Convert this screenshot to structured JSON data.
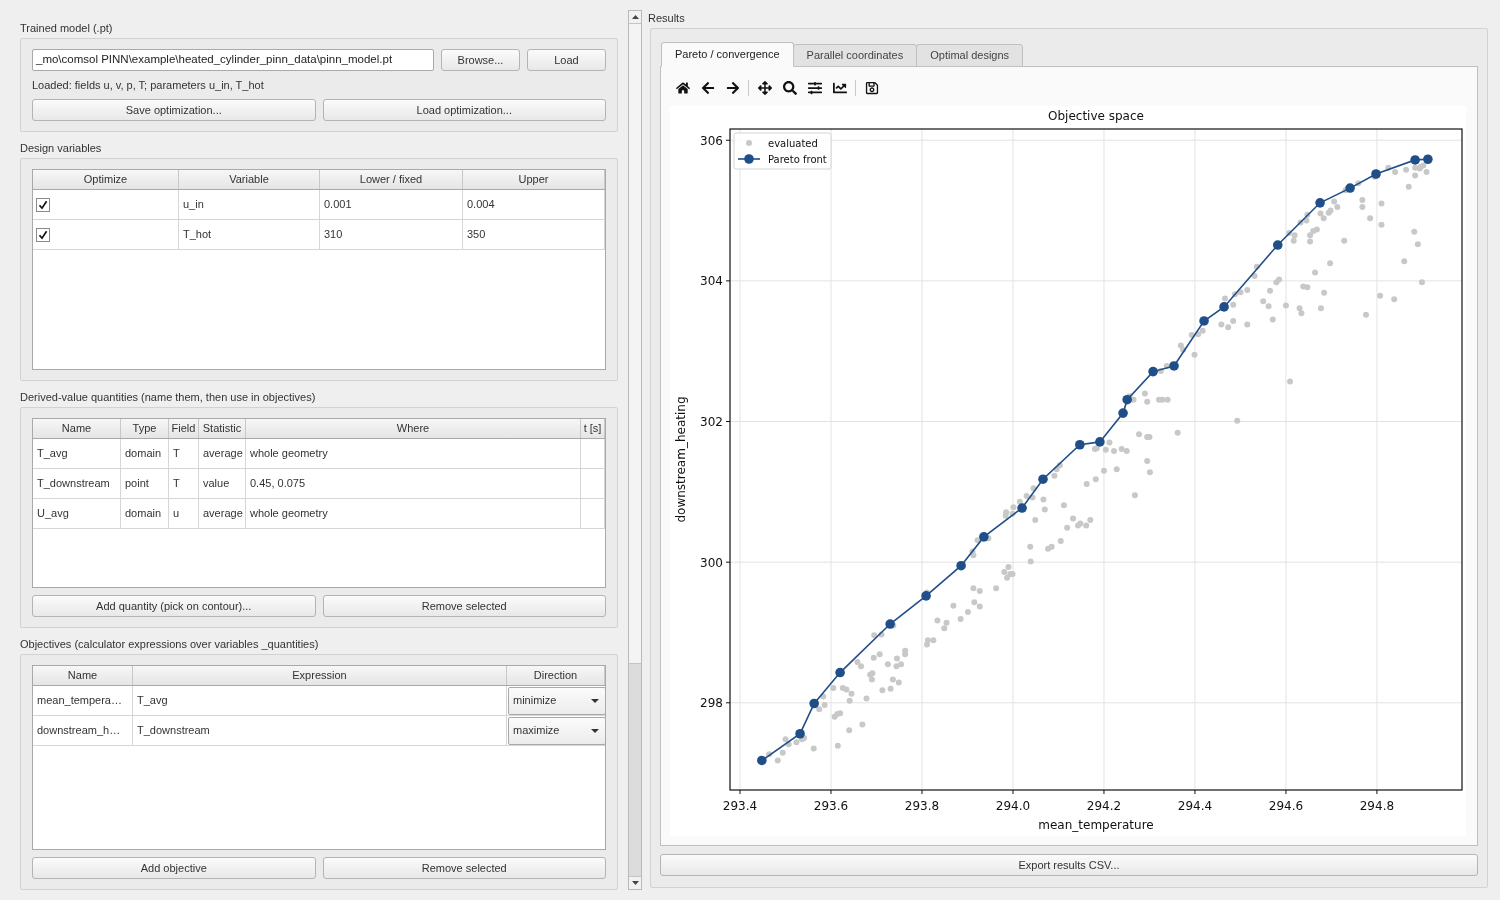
{
  "trained_model": {
    "title": "Trained model (.pt)",
    "path_field": {
      "value": "_mo\\comsol PINN\\example\\heated_cylinder_pinn_data\\pinn_model.pt"
    },
    "buttons": [
      "Browse...",
      "Load"
    ],
    "status": "Loaded: fields u, v, p, T; parameters u_in, T_hot",
    "file_buttons": [
      "Save optimization...",
      "Load optimization..."
    ]
  },
  "design_variables": {
    "title": "Design variables",
    "columns": [
      "Optimize",
      "Variable",
      "Lower / fixed",
      "Upper"
    ],
    "rows": [
      {
        "checked": true,
        "variable": "u_in",
        "lower": "0.001",
        "upper": "0.004"
      },
      {
        "checked": true,
        "variable": "T_hot",
        "lower": "310",
        "upper": "350"
      }
    ]
  },
  "quantities": {
    "title": "Derived-value quantities (name them, then use in objectives)",
    "columns": [
      "Name",
      "Type",
      "Field",
      "Statistic",
      "Where",
      "t [s]"
    ],
    "rows": [
      {
        "name": "T_avg",
        "type": "domain",
        "field": "T",
        "statistic": "average",
        "where": "whole geometry"
      },
      {
        "name": "T_downstream",
        "type": "point",
        "field": "T",
        "statistic": "value",
        "where": "0.45, 0.075"
      },
      {
        "name": "U_avg",
        "type": "domain",
        "field": "u",
        "statistic": "average",
        "where": "whole geometry"
      }
    ],
    "buttons": [
      "Add quantity (pick on contour)...",
      "Remove selected"
    ]
  },
  "objectives": {
    "title": "Objectives (calculator expressions over variables _quantities)",
    "columns": [
      "Name",
      "Expression",
      "Direction"
    ],
    "rows": [
      {
        "name": "mean_tempera…",
        "expression": "T_avg",
        "direction": "minimize"
      },
      {
        "name": "downstream_h…",
        "expression": "T_downstream",
        "direction": "maximize"
      }
    ],
    "buttons": [
      "Add objective",
      "Remove selected"
    ]
  },
  "results": {
    "title": "Results",
    "tabs": [
      {
        "label": "Pareto / convergence",
        "selected": true
      },
      {
        "label": "Parallel coordinates",
        "selected": false
      },
      {
        "label": "Optimal designs",
        "selected": false
      }
    ],
    "chart_data": {
      "type": "scatter",
      "title": "Objective space",
      "xlabel": "mean_temperature",
      "ylabel": "downstream_heating",
      "grid": true,
      "legend": "upper left",
      "xlim": [
        293.378,
        294.987
      ],
      "ylim": [
        296.76,
        306.16
      ],
      "xticks": [
        {
          "value": 293.4,
          "label": "293.4"
        },
        {
          "value": 293.6,
          "label": "293.6"
        },
        {
          "value": 293.8,
          "label": "293.8"
        },
        {
          "value": 294,
          "label": "294.0"
        },
        {
          "value": 294.2,
          "label": "294.2"
        },
        {
          "value": 294.4,
          "label": "294.4"
        },
        {
          "value": 294.6,
          "label": "294.6"
        },
        {
          "value": 294.8,
          "label": "294.8"
        }
      ],
      "yticks": [
        298,
        300,
        302,
        304,
        306
      ],
      "series": [
        {
          "name": "evaluated",
          "type": "scatter",
          "color": "#c8c8c8",
          "x": [
            293.464,
            293.483,
            293.494,
            293.5,
            293.507,
            293.524,
            293.536,
            293.541,
            293.562,
            293.574,
            293.586,
            293.583,
            293.608,
            293.614,
            293.62,
            293.615,
            293.605,
            293.626,
            293.634,
            293.641,
            293.645,
            293.64,
            293.658,
            293.666,
            293.669,
            293.678,
            293.686,
            293.69,
            293.691,
            293.694,
            293.707,
            293.713,
            293.725,
            293.731,
            293.736,
            293.744,
            293.745,
            293.749,
            293.754,
            293.763,
            293.763,
            293.711,
            293.695,
            293.737,
            293.811,
            293.811,
            293.813,
            293.825,
            293.834,
            293.854,
            293.849,
            293.869,
            293.885,
            293.901,
            293.913,
            293.915,
            293.927,
            293.927,
            293.911,
            293.913,
            293.922,
            293.963,
            293.981,
            293.99,
            293.994,
            293.987,
            293.999,
            294.038,
            294.039,
            294.049,
            294.077,
            294.085,
            294.105,
            294.119,
            294.132,
            294.143,
            294.148,
            294.161,
            294.17,
            293.984,
            293.999,
            293.946,
            293.985,
            294.001,
            294.015,
            294.03,
            294.045,
            294.043,
            294.067,
            294.07,
            294.091,
            294.096,
            294.103,
            294.112,
            294.162,
            294.18,
            294.184,
            294.182,
            294.2,
            294.204,
            294.212,
            294.222,
            294.228,
            294.239,
            294.25,
            294.268,
            294.277,
            294.295,
            294.3,
            294.295,
            294.301,
            294.295,
            294.29,
            294.265,
            294.256,
            294.321,
            294.864,
            294.884,
            294.896,
            294.909,
            294.884,
            294.87,
            294.81,
            294.768,
            294.768,
            294.785,
            294.81,
            294.728,
            294.713,
            294.698,
            294.694,
            294.683,
            294.676,
            294.66,
            294.668,
            294.653,
            294.653,
            294.619,
            294.617,
            294.607,
            294.645,
            294.647,
            294.632,
            294.882,
            294.89,
            294.86,
            294.899,
            294.807,
            294.838,
            294.776,
            294.697,
            294.664,
            294.684,
            294.677,
            294.634,
            294.63,
            294.6,
            294.571,
            294.562,
            294.55,
            294.579,
            294.585,
            294.565,
            294.638,
            294.647,
            294.536,
            294.531,
            294.515,
            294.5,
            294.488,
            294.484,
            294.466,
            294.458,
            294.473,
            294.484,
            294.515,
            294.493,
            294.609,
            294.417,
            294.407,
            294.393,
            294.399,
            294.369,
            294.374,
            294.338,
            294.325,
            294.328,
            294.34,
            294.362,
            294.759,
            294.731,
            294.706,
            294.795,
            294.825,
            294.84,
            294.894,
            294.902
          ],
          "values": [
            297.27,
            297.18,
            297.29,
            297.48,
            297.41,
            297.44,
            297.48,
            297.5,
            297.35,
            297.91,
            297.97,
            298.09,
            297.8,
            297.84,
            297.85,
            297.39,
            298.21,
            298.21,
            298.19,
            298.03,
            298.13,
            297.61,
            298.58,
            298.52,
            297.69,
            298.06,
            298.4,
            298.33,
            298.42,
            298.64,
            298.69,
            298.18,
            298.55,
            298.2,
            298.33,
            298.52,
            298.63,
            298.29,
            298.55,
            298.74,
            298.69,
            298.97,
            298.96,
            299.1,
            299.57,
            298.83,
            298.89,
            298.89,
            299.17,
            299.14,
            299.06,
            299.38,
            299.19,
            299.29,
            299.63,
            299.43,
            299.59,
            299.37,
            300.15,
            300.1,
            300.31,
            299.63,
            299.86,
            299.93,
            299.83,
            299.78,
            299.83,
            300.22,
            300.01,
            300.6,
            300.19,
            300.22,
            300.3,
            300.49,
            300.62,
            300.52,
            300.55,
            300.52,
            300.6,
            300.66,
            300.69,
            300.34,
            300.71,
            300.78,
            300.86,
            300.94,
            301.05,
            300.92,
            300.89,
            300.75,
            301.23,
            301.32,
            301.38,
            300.81,
            301.11,
            301.61,
            301.62,
            301.18,
            301.3,
            301.6,
            301.7,
            301.58,
            301.32,
            301.61,
            301.58,
            300.95,
            301.82,
            301.78,
            301.78,
            301.44,
            301.28,
            302.28,
            302.4,
            302.31,
            302.36,
            302.31,
            305.58,
            305.61,
            305.62,
            305.55,
            305.5,
            305.34,
            305.1,
            305.15,
            305.05,
            304.89,
            304.8,
            304.57,
            305.05,
            305,
            304.97,
            304.89,
            304.96,
            304.71,
            304.73,
            304.65,
            304.56,
            304.65,
            304.57,
            304.68,
            304.86,
            304.94,
            304.83,
            304.7,
            304.52,
            304.28,
            303.98,
            303.79,
            303.74,
            303.52,
            304.25,
            304.12,
            303.83,
            303.61,
            303.54,
            303.61,
            303.65,
            303.45,
            303.64,
            303.71,
            303.98,
            304.02,
            303.86,
            303.92,
            303.91,
            304.2,
            304.07,
            303.87,
            303.84,
            303.81,
            303.66,
            303.75,
            303.38,
            303.34,
            303.43,
            303.38,
            302.01,
            302.57,
            303.29,
            303.24,
            303.23,
            302.95,
            303.08,
            303.02,
            302.79,
            302.72,
            302.31,
            302.31,
            301.84,
            305.39,
            305.29,
            305.13,
            305.48,
            305.61,
            305.55,
            305.6,
            305.64
          ]
        },
        {
          "name": "Pareto front",
          "type": "line",
          "marker": "o",
          "color": "#1f4e89",
          "x": [
            293.448,
            293.532,
            293.563,
            293.62,
            293.73,
            293.809,
            293.886,
            293.936,
            294.02,
            294.066,
            294.147,
            294.191,
            294.242,
            294.251,
            294.308,
            294.354,
            294.42,
            294.464,
            294.582,
            294.675,
            294.741,
            294.798,
            294.884,
            294.912
          ],
          "values": [
            297.18,
            297.56,
            297.99,
            298.43,
            299.12,
            299.52,
            299.95,
            300.36,
            300.77,
            301.18,
            301.67,
            301.71,
            302.12,
            302.31,
            302.71,
            302.79,
            303.43,
            303.63,
            304.51,
            305.11,
            305.32,
            305.52,
            305.72,
            305.73
          ]
        }
      ]
    },
    "export_button": "Export results CSV..."
  }
}
